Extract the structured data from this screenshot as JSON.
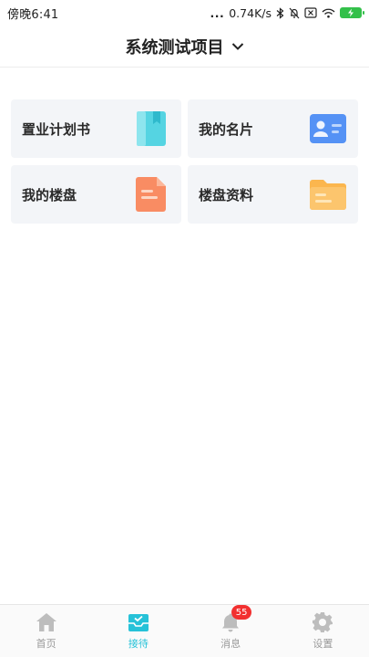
{
  "status_bar": {
    "time": "傍晚6:41",
    "more": "...",
    "speed": "0.74K/s",
    "icons": [
      "bluetooth-icon",
      "mute-bell-icon",
      "sim-off-icon",
      "wifi-icon",
      "battery-charging-icon"
    ],
    "battery_color": "#33c04a"
  },
  "header": {
    "title": "系统测试项目",
    "dropdown_icon": "chevron-down-icon"
  },
  "menu": {
    "items": [
      {
        "label": "置业计划书",
        "icon": "book-icon",
        "color": "#52d3e0"
      },
      {
        "label": "我的名片",
        "icon": "business-card-icon",
        "color": "#4f8df5"
      },
      {
        "label": "我的楼盘",
        "icon": "document-icon",
        "color": "#f88a5f"
      },
      {
        "label": "楼盘资料",
        "icon": "folder-icon",
        "color": "#fbb54c"
      }
    ]
  },
  "tab_bar": {
    "tabs": [
      {
        "label": "首页",
        "icon": "home-icon",
        "active": false
      },
      {
        "label": "接待",
        "icon": "inbox-icon",
        "active": true
      },
      {
        "label": "消息",
        "icon": "bell-icon",
        "active": false,
        "badge": "55"
      },
      {
        "label": "设置",
        "icon": "gear-icon",
        "active": false
      }
    ],
    "active_color": "#26c2d8",
    "inactive_color": "#bdbdbd"
  }
}
